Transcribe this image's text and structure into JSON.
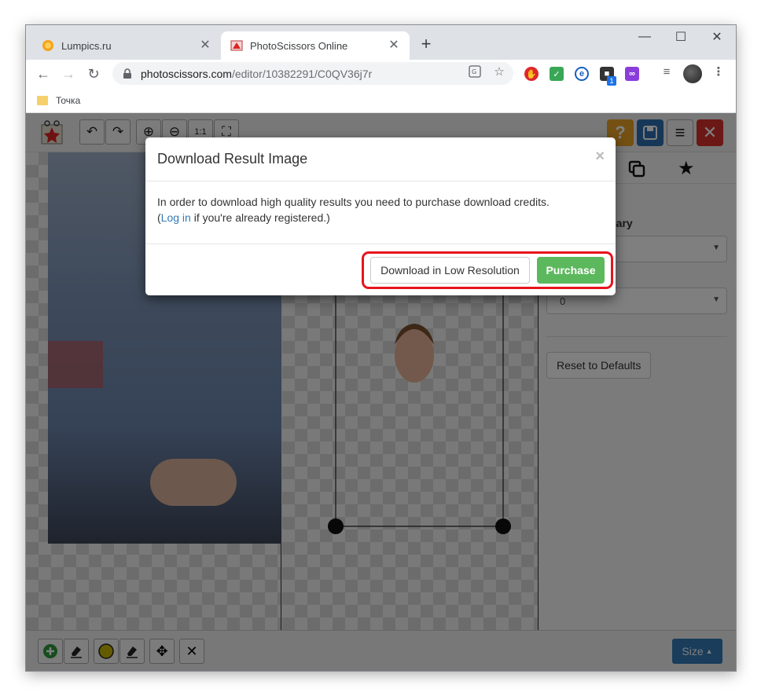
{
  "browser": {
    "tabs": [
      {
        "title": "Lumpics.ru",
        "favicon": "orange-circle-icon"
      },
      {
        "title": "PhotoScissors Online",
        "favicon": "photoscissors-icon"
      }
    ],
    "new_tab": "+",
    "window_controls": {
      "minimize": "—",
      "maximize": "☐",
      "close": "✕"
    },
    "url_host": "photoscissors.com",
    "url_path": "/editor/10382291/C0QV36j7r",
    "extension_badge": "1",
    "bookmark_label": "Точка"
  },
  "modal": {
    "title": "Download Result Image",
    "close": "×",
    "body_text": "In order to download high quality results you need to purchase download credits.",
    "link_prefix": "(",
    "login_link": "Log in",
    "link_suffix": " if you're already registered.)",
    "low_res_button": "Download in Low Resolution",
    "purchase_button": "Purchase"
  },
  "editor": {
    "side_partial_1": "d",
    "side_partial_2": "undary",
    "select_value": "0",
    "reset_button": "Reset to Defaults",
    "size_button": "Size"
  },
  "colors": {
    "accent_blue": "#337ab7",
    "purchase_green": "#5cb85c",
    "highlight_red": "#e8141c"
  }
}
